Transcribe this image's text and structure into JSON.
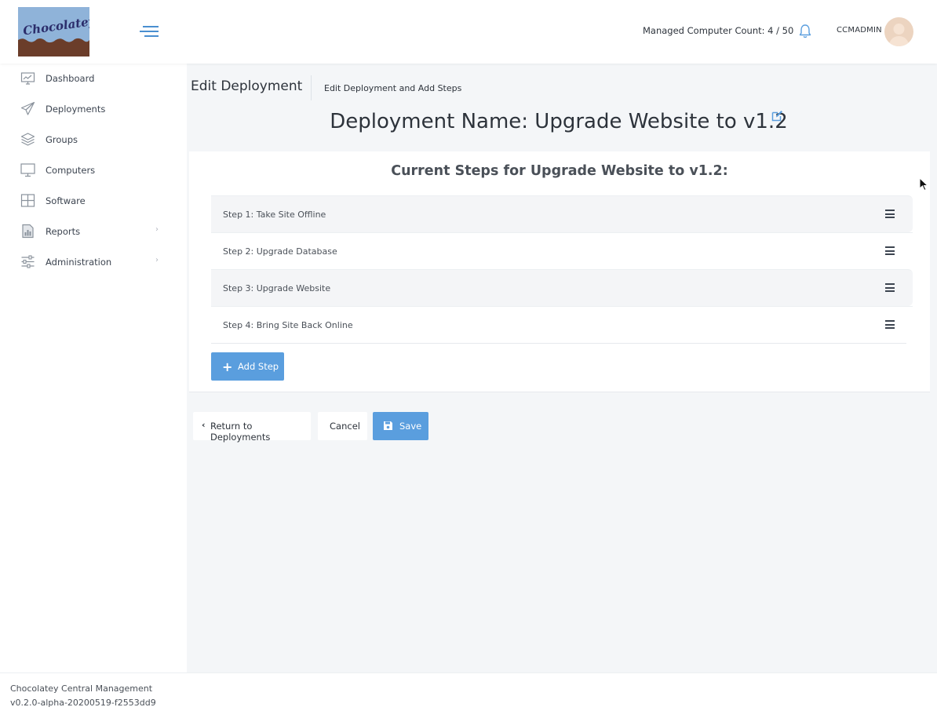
{
  "header": {
    "logo_text": "Chocolatey",
    "managed_count": "Managed Computer Count: 4 / 50",
    "username": "CCMADMIN",
    "accent_color": "#5a9ede"
  },
  "sidebar": {
    "items": [
      {
        "label": "Dashboard",
        "icon": "dashboard-icon"
      },
      {
        "label": "Deployments",
        "icon": "paper-plane-icon"
      },
      {
        "label": "Groups",
        "icon": "layers-icon"
      },
      {
        "label": "Computers",
        "icon": "monitor-icon"
      },
      {
        "label": "Software",
        "icon": "grid-icon"
      },
      {
        "label": "Reports",
        "icon": "report-icon",
        "chevron": "›"
      },
      {
        "label": "Administration",
        "icon": "sliders-icon",
        "chevron": "›"
      }
    ]
  },
  "main": {
    "page_title": "Edit Deployment",
    "breadcrumb": "Edit Deployment and Add Steps",
    "deployment_name": "Deployment Name: Upgrade Website to v1.2",
    "steps_title": "Current Steps for Upgrade Website to v1.2:",
    "steps": [
      {
        "label": "Step 1: Take Site Offline"
      },
      {
        "label": "Step 2: Upgrade Database"
      },
      {
        "label": "Step 3: Upgrade Website"
      },
      {
        "label": "Step 4: Bring Site Back Online"
      }
    ],
    "add_step_label": "Add Step",
    "return_label": "Return to Deployments",
    "cancel_label": "Cancel",
    "save_label": "Save"
  },
  "footer": {
    "app_name": "Chocolatey Central Management",
    "version": "v0.2.0-alpha-20200519-f2553dd9"
  }
}
